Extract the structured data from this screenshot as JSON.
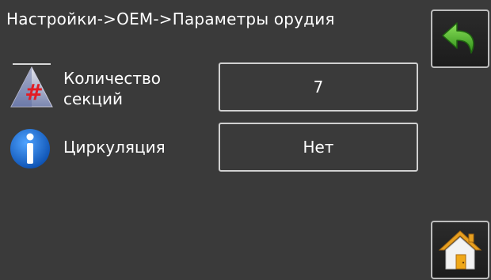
{
  "header": {
    "title": "Настройки->OEM->Параметры орудия"
  },
  "params": [
    {
      "label_line1": "Количество",
      "label_line2": "секций",
      "value": "7",
      "icon": "sections-hash-icon"
    },
    {
      "label": "Циркуляция",
      "value": "Нет",
      "icon": "info-icon"
    }
  ],
  "nav": {
    "back_icon": "back-arrow-icon",
    "home_icon": "home-icon"
  },
  "colors": {
    "background": "#3a3a3a",
    "back_arrow": "#58b82e",
    "info_blue": "#1a6fd6",
    "home_wall": "#f2f2f2",
    "home_roof": "#e8a020",
    "hash_red": "#e31b23"
  }
}
